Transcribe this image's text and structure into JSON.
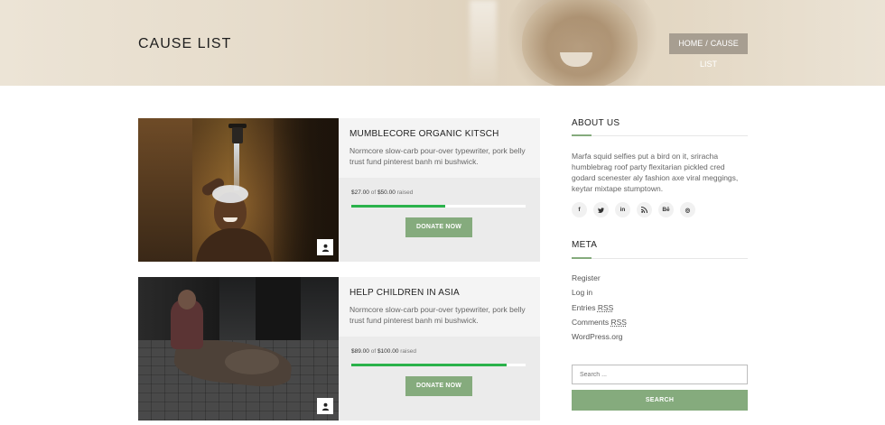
{
  "hero": {
    "title": "CAUSE LIST",
    "breadcrumb": {
      "home": "HOME",
      "separator": "/",
      "current": "CAUSE LIST"
    }
  },
  "causes": [
    {
      "title": "MUMBLECORE ORGANIC KITSCH",
      "description": "Normcore slow-carb pour-over typewriter, pork belly trust fund pinterest banh mi bushwick.",
      "raised": "$27.00",
      "of_label": "of",
      "goal": "$50.00",
      "raised_label": "raised",
      "progress_fraction": 0.54,
      "donate_label": "DONATE NOW",
      "image_icon": "user-icon"
    },
    {
      "title": "HELP CHILDREN IN ASIA",
      "description": "Normcore slow-carb pour-over typewriter, pork belly trust fund pinterest banh mi bushwick.",
      "raised": "$89.00",
      "of_label": "of",
      "goal": "$100.00",
      "raised_label": "raised",
      "progress_fraction": 0.89,
      "donate_label": "DONATE NOW",
      "image_icon": "user-icon"
    }
  ],
  "sidebar": {
    "about": {
      "heading": "ABOUT US",
      "text": "Marfa squid selfies put a bird on it, sriracha humblebrag roof party flexitarian pickled cred godard scenester aly fashion axe viral meggings, keytar mixtape stumptown."
    },
    "social": [
      {
        "icon": "facebook-icon",
        "glyph": "f"
      },
      {
        "icon": "twitter-icon",
        "glyph": "❧"
      },
      {
        "icon": "linkedin-icon",
        "glyph": "in"
      },
      {
        "icon": "rss-icon",
        "glyph": "☲"
      },
      {
        "icon": "behance-icon",
        "glyph": "Bē"
      },
      {
        "icon": "dribbble-icon",
        "glyph": "◎"
      }
    ],
    "meta": {
      "heading": "META",
      "items": [
        "Register",
        "Log in",
        "Entries",
        "Comments",
        "WordPress.org"
      ],
      "rss": "RSS"
    },
    "search": {
      "placeholder": "Search ...",
      "button_label": "SEARCH"
    }
  },
  "colors": {
    "accent": "#85ab7d",
    "progress": "#2ab24b",
    "breadcrumb_bg": "#a79e91"
  }
}
